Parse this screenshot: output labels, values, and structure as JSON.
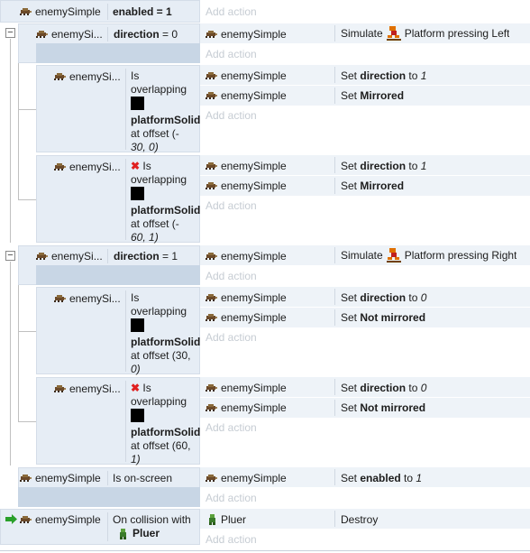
{
  "object_name": "enemySimple",
  "object_name_truncated": "enemySi...",
  "add_action": "Add action",
  "icons": {
    "object": "enemy-sprite-icon",
    "platform": "platform-behavior-icon",
    "invert": "red-x-icon",
    "trigger": "green-arrow-icon",
    "player": "player-sprite-icon"
  },
  "colors": {
    "condition_bg": "#e6edf5",
    "selected_bg": "#c8d6e5",
    "invert": "#e02020",
    "trigger": "#2aa02a"
  },
  "events": {
    "e1": {
      "cond_text": "enabled = 1"
    },
    "e2": {
      "cond_label": "direction",
      "cond_rest": " = 0",
      "action": {
        "prefix": "Simulate",
        "suffix": "Platform pressing Left"
      }
    },
    "e2a": {
      "cond_lines": [
        "Is",
        "overlapping"
      ],
      "obj": "platformSolid",
      "tail1": " at offset (-",
      "tail2": "30, 0)",
      "act1": {
        "prefix": "Set ",
        "bold": "direction",
        "mid": " to ",
        "val": "1"
      },
      "act2": {
        "prefix": "Set ",
        "bold": "Mirrored"
      }
    },
    "e2b": {
      "cond_lines": [
        "Is",
        "overlapping"
      ],
      "obj": "platformSolid",
      "tail1": " at offset (-",
      "tail2": "60, 1)",
      "act1": {
        "prefix": "Set ",
        "bold": "direction",
        "mid": " to ",
        "val": "1"
      },
      "act2": {
        "prefix": "Set ",
        "bold": "Mirrored"
      }
    },
    "e3": {
      "cond_label": "direction",
      "cond_rest": " = 1",
      "action": {
        "prefix": "Simulate",
        "suffix": "Platform pressing Right"
      }
    },
    "e3a": {
      "cond_lines": [
        "Is",
        "overlapping"
      ],
      "obj": "platformSolid",
      "tail1": " at offset (30,",
      "tail2": "0)",
      "act1": {
        "prefix": "Set ",
        "bold": "direction",
        "mid": " to ",
        "val": "0"
      },
      "act2": {
        "prefix": "Set ",
        "bold": "Not mirrored"
      }
    },
    "e3b": {
      "cond_lines": [
        "Is",
        "overlapping"
      ],
      "obj": "platformSolid",
      "tail1": " at offset (60,",
      "tail2": "1)",
      "act1": {
        "prefix": "Set ",
        "bold": "direction",
        "mid": " to ",
        "val": "0"
      },
      "act2": {
        "prefix": "Set ",
        "bold": "Not mirrored"
      }
    },
    "e4": {
      "cond_text": "Is on-screen",
      "act": {
        "prefix": "Set ",
        "bold": "enabled",
        "mid": " to ",
        "val": "1"
      }
    },
    "e5": {
      "cond_line1": "On collision with",
      "cond_obj": "Pluer",
      "act_obj": "Pluer",
      "act_text": "Destroy"
    }
  }
}
